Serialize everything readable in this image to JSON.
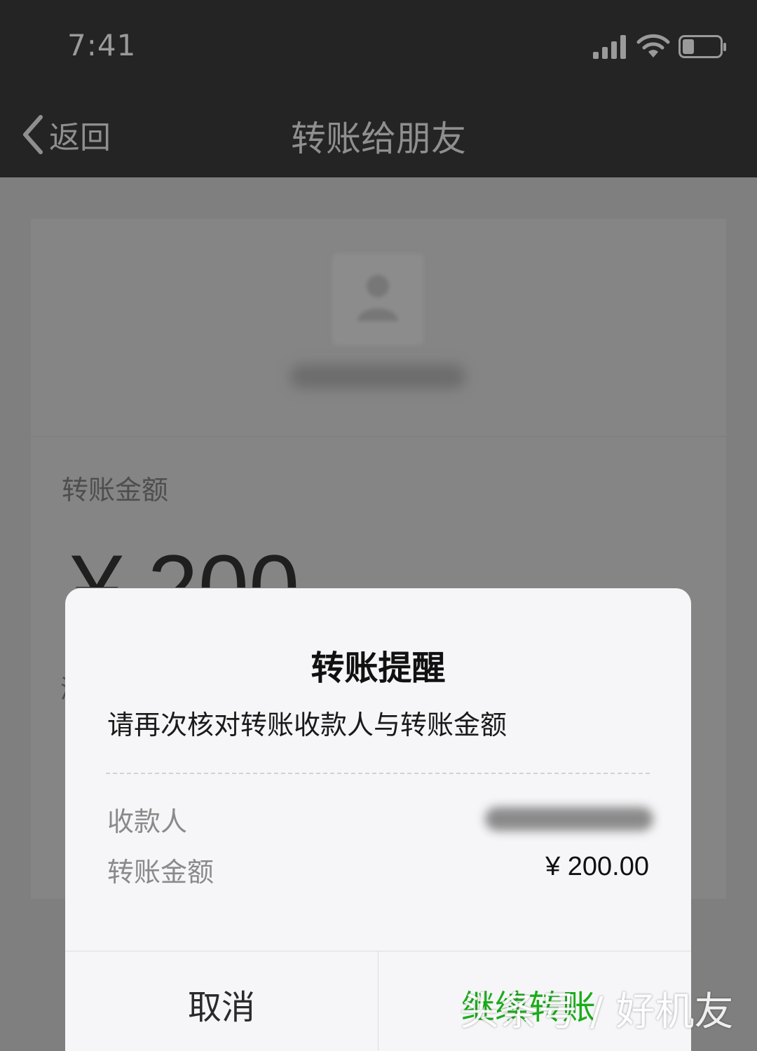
{
  "status_bar": {
    "time": "7:41",
    "signal_icon": "signal-bars-icon",
    "wifi_icon": "wifi-icon",
    "battery_icon": "battery-icon"
  },
  "nav": {
    "back_label": "返回",
    "title": "转账给朋友"
  },
  "page": {
    "amount_label": "转账金额",
    "amount_display": "¥ 200",
    "hint_char": "添"
  },
  "dialog": {
    "title": "转账提醒",
    "message": "请再次核对转账收款人与转账金额",
    "payee_label": "收款人",
    "amount_label": "转账金额",
    "amount_value": "¥ 200.00",
    "cancel_label": "取消",
    "continue_label": "继续转账"
  },
  "watermark": "头条号 / 好机友",
  "colors": {
    "accent_green": "#1aad19",
    "nav_background": "#242424"
  }
}
